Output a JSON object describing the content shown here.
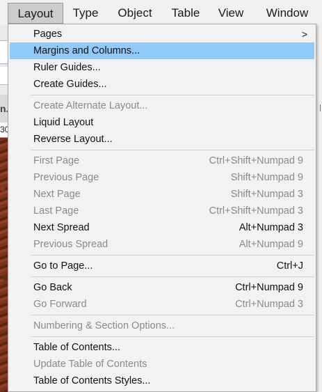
{
  "menubar": {
    "items": [
      "Layout",
      "Type",
      "Object",
      "Table",
      "View",
      "Window"
    ]
  },
  "background": {
    "tab_text": "n.i",
    "ruler_text": "30"
  },
  "menu": {
    "items": [
      {
        "label": "Pages",
        "shortcut": "",
        "enabled": true,
        "submenu_arrow": ">"
      },
      {
        "label": "Margins and Columns...",
        "shortcut": "",
        "enabled": true,
        "highlighted": true
      },
      {
        "label": "Ruler Guides...",
        "shortcut": "",
        "enabled": true
      },
      {
        "label": "Create Guides...",
        "shortcut": "",
        "enabled": true
      },
      {
        "label": "Create Alternate Layout...",
        "shortcut": "",
        "enabled": false
      },
      {
        "label": "Liquid Layout",
        "shortcut": "",
        "enabled": true
      },
      {
        "label": "Reverse Layout...",
        "shortcut": "",
        "enabled": true
      },
      {
        "label": "First Page",
        "shortcut": "Ctrl+Shift+Numpad 9",
        "enabled": false
      },
      {
        "label": "Previous Page",
        "shortcut": "Shift+Numpad 9",
        "enabled": false
      },
      {
        "label": "Next Page",
        "shortcut": "Shift+Numpad 3",
        "enabled": false
      },
      {
        "label": "Last Page",
        "shortcut": "Ctrl+Shift+Numpad 3",
        "enabled": false
      },
      {
        "label": "Next Spread",
        "shortcut": "Alt+Numpad 3",
        "enabled": true
      },
      {
        "label": "Previous Spread",
        "shortcut": "Alt+Numpad 9",
        "enabled": false
      },
      {
        "label": "Go to Page...",
        "shortcut": "Ctrl+J",
        "enabled": true
      },
      {
        "label": "Go Back",
        "shortcut": "Ctrl+Numpad 9",
        "enabled": true
      },
      {
        "label": "Go Forward",
        "shortcut": "Ctrl+Numpad 3",
        "enabled": false
      },
      {
        "label": "Numbering & Section Options...",
        "shortcut": "",
        "enabled": false
      },
      {
        "label": "Table of Contents...",
        "shortcut": "",
        "enabled": true
      },
      {
        "label": "Update Table of Contents",
        "shortcut": "",
        "enabled": false
      },
      {
        "label": "Table of Contents Styles...",
        "shortcut": "",
        "enabled": true
      }
    ]
  },
  "colors": {
    "highlight": "#91c9f7",
    "disabled_text": "#8a8a8a",
    "menu_bg": "#f2f2f2"
  }
}
